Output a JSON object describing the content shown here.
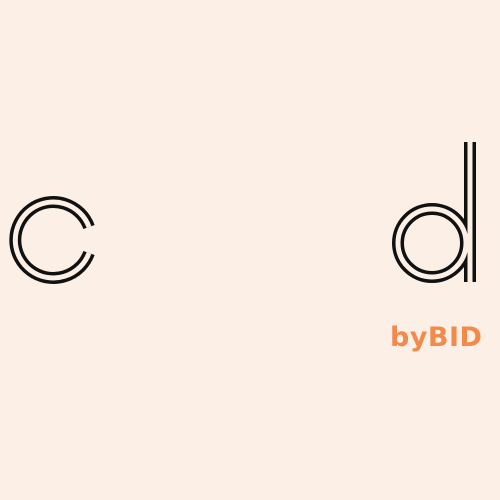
{
  "brand": {
    "letters": [
      "c",
      "d"
    ],
    "tagline": "byBID"
  },
  "colors": {
    "background": "#fcefe5",
    "letter_stroke": "#111111",
    "accent": "#f28a4c"
  }
}
